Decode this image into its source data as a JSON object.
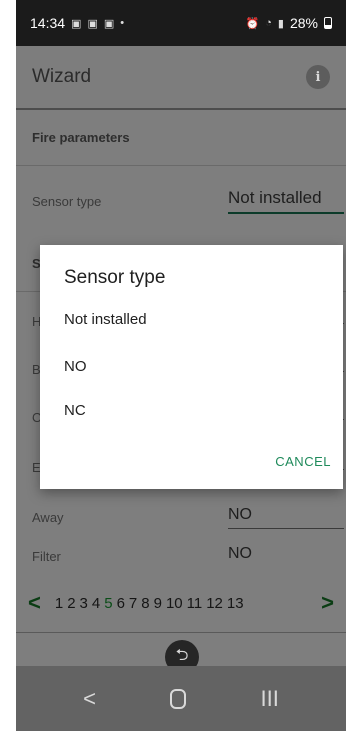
{
  "status_bar": {
    "time": "14:34",
    "left_icons": [
      "notification-icon",
      "notification-icon",
      "notification-icon",
      "dot"
    ],
    "battery_percent": "28%"
  },
  "app_bar": {
    "title": "Wizard",
    "info_icon_glyph": "i"
  },
  "content": {
    "section1_title": "Fire parameters",
    "sensor_type_label": "Sensor type",
    "sensor_type_value": "Not installed",
    "section2_title_partial": "S",
    "partial_labels": [
      "H",
      "B",
      "O",
      "E"
    ],
    "away_label": "Away",
    "away_value": "NO",
    "filter_label": "Filter",
    "filter_value": "NO"
  },
  "pager": {
    "prev_glyph": "<",
    "next_glyph": ">",
    "pages": [
      "1",
      "2",
      "3",
      "4",
      "5",
      "6",
      "7",
      "8",
      "9",
      "10",
      "11",
      "12",
      "13"
    ],
    "current_page": "5"
  },
  "dialog": {
    "title": "Sensor type",
    "options": [
      "Not installed",
      "NO",
      "NC"
    ],
    "cancel_label": "CANCEL"
  },
  "nav_bar": {
    "back_glyph": "<",
    "recents_glyph": "III"
  },
  "colors": {
    "accent": "#1f8a5b",
    "pager_arrow": "#0b3d14",
    "overlay": "#7e7e7e"
  }
}
